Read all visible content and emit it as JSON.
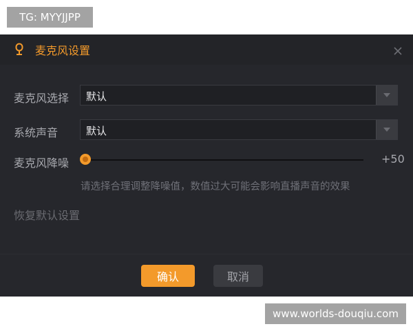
{
  "watermarks": {
    "top": "TG: MYYJJPP",
    "bottom": "www.worlds-douqiu.com"
  },
  "dialog": {
    "title": "麦克风设置",
    "title_icon": "microphone-icon",
    "close_icon": "close-icon",
    "accent_color": "#f39a2b",
    "mic_select": {
      "label": "麦克风选择",
      "value": "默认"
    },
    "system_sound": {
      "label": "系统声音",
      "value": "默认"
    },
    "noise_reduction": {
      "label": "麦克风降噪",
      "value": "+50"
    },
    "hint": "请选择合理调整降噪值，数值过大可能会影响直播声音的效果",
    "reset_label": "恢复默认设置",
    "confirm_label": "确认",
    "cancel_label": "取消"
  }
}
